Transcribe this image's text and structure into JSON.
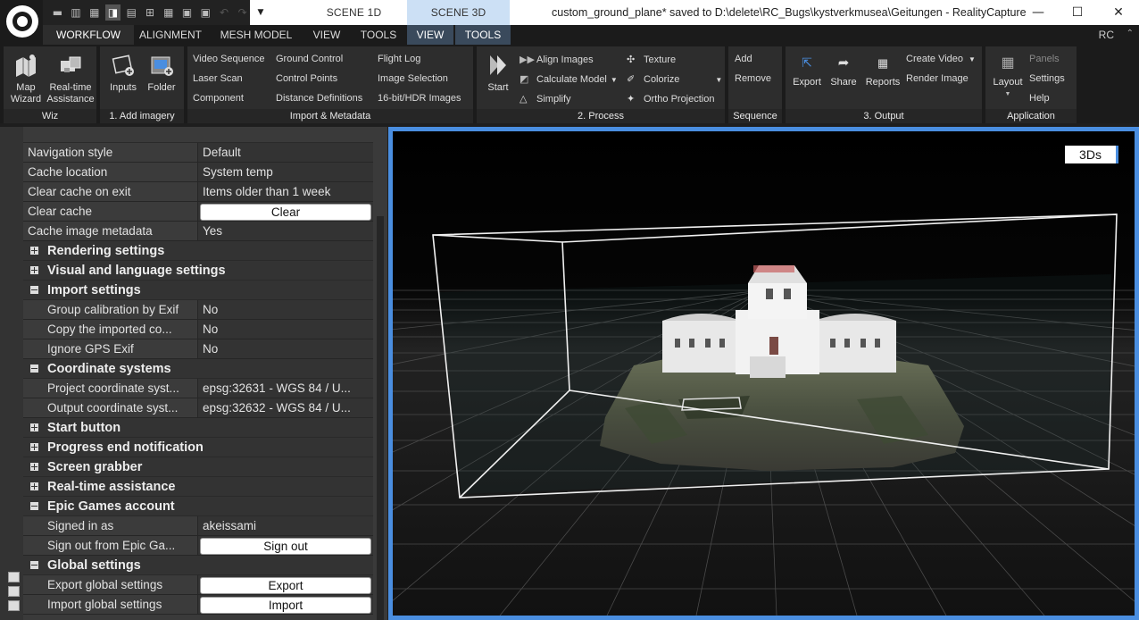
{
  "titlebar": {
    "scene_tabs": [
      "SCENE 1D",
      "SCENE 3D"
    ],
    "title": "custom_ground_plane* saved to D:\\delete\\RC_Bugs\\kystverkmusea\\Geitungen - RealityCapture",
    "controls": {
      "minimize": "—",
      "maximize": "☐",
      "close": "✕"
    }
  },
  "menu": {
    "tabs": [
      "WORKFLOW",
      "ALIGNMENT",
      "MESH MODEL",
      "VIEW",
      "TOOLS",
      "VIEW",
      "TOOLS"
    ],
    "right_label": "RC"
  },
  "ribbon": {
    "wiz": {
      "label": "Wiz",
      "map_wizard": "Map\nWizard",
      "realtime": "Real-time\nAssistance"
    },
    "add_imagery": {
      "label": "1. Add imagery",
      "inputs": "Inputs",
      "folder": "Folder"
    },
    "import_metadata": {
      "label": "Import & Metadata",
      "items": [
        "Video Sequence",
        "Laser Scan",
        "Component",
        "Ground Control",
        "Control Points",
        "Distance Definitions",
        "Flight Log",
        "Image Selection",
        "16-bit/HDR Images"
      ]
    },
    "process": {
      "label": "2. Process",
      "start": "Start",
      "items": [
        "Align Images",
        "Calculate Model",
        "Simplify",
        "Texture",
        "Colorize",
        "Ortho Projection"
      ]
    },
    "sequence": {
      "label": "Sequence",
      "add": "Add",
      "remove": "Remove"
    },
    "output": {
      "label": "3. Output",
      "export": "Export",
      "share": "Share",
      "reports": "Reports",
      "create_video": "Create Video",
      "render_image": "Render Image"
    },
    "application": {
      "label": "Application",
      "layout": "Layout",
      "panels": "Panels",
      "settings": "Settings",
      "help": "Help"
    }
  },
  "settings": {
    "rows_top": [
      {
        "key": "Navigation style",
        "value": "Default"
      },
      {
        "key": "Cache location",
        "value": "System temp"
      },
      {
        "key": "Clear cache on exit",
        "value": "Items older than 1 week"
      }
    ],
    "clear_cache": {
      "key": "Clear cache",
      "button": "Clear"
    },
    "cache_metadata": {
      "key": "Cache image metadata",
      "value": "Yes"
    },
    "sections": {
      "rendering": "Rendering settings",
      "visual": "Visual and language settings",
      "import": "Import settings",
      "coordinate": "Coordinate systems",
      "start_button": "Start button",
      "progress": "Progress end notification",
      "screen_grabber": "Screen grabber",
      "realtime": "Real-time assistance",
      "epic": "Epic Games account",
      "global": "Global settings"
    },
    "import_rows": [
      {
        "key": "Group calibration by Exif",
        "value": "No"
      },
      {
        "key": "Copy the imported co...",
        "value": "No"
      },
      {
        "key": "Ignore GPS Exif",
        "value": "No"
      }
    ],
    "coord_rows": [
      {
        "key": "Project coordinate syst...",
        "value": "epsg:32631 - WGS 84 / U..."
      },
      {
        "key": "Output coordinate syst...",
        "value": "epsg:32632 - WGS 84 / U..."
      }
    ],
    "epic_rows": {
      "signed_in_key": "Signed in as",
      "signed_in_value": "akeissami",
      "signout_key": "Sign out from Epic Ga...",
      "signout_button": "Sign out"
    },
    "global_rows": {
      "export_key": "Export global settings",
      "export_button": "Export",
      "import_key": "Import global settings",
      "import_button": "Import"
    }
  },
  "viewport": {
    "badge": "3Ds"
  },
  "colors": {
    "accent": "#4a8ee0",
    "ribbon_bg": "#2d2d2d",
    "panel_bg": "#3a3a3a"
  }
}
